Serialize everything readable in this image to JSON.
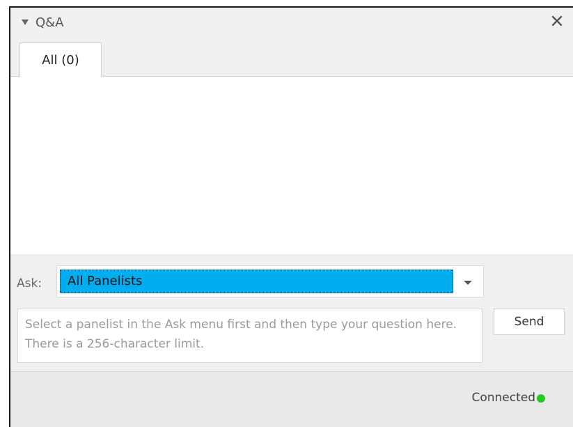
{
  "panel": {
    "title": "Q&A",
    "collapse_icon": "triangle-down-icon",
    "close_icon": "close-icon"
  },
  "tabs": [
    {
      "label": "All (0)",
      "selected": true
    }
  ],
  "ask": {
    "label": "Ask:",
    "selected_option": "All Panelists",
    "dropdown_icon": "chevron-down-icon"
  },
  "question": {
    "placeholder": "Select a panelist in the Ask menu first and then type your question here. There is a 256-character limit.",
    "value": ""
  },
  "send_button": {
    "label": "Send"
  },
  "status": {
    "text": "Connected",
    "indicator_color": "#22cc1f"
  },
  "colors": {
    "selection": "#00aeef"
  }
}
